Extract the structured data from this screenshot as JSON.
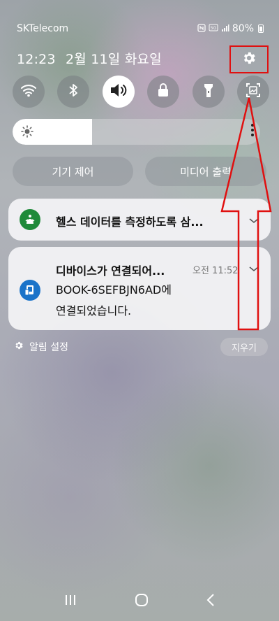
{
  "status_bar": {
    "carrier": "SKTelecom",
    "battery": "80%",
    "icons": [
      "nfc-icon",
      "5g-icon",
      "signal-icon",
      "battery-icon"
    ]
  },
  "header": {
    "time": "12:23",
    "date": "2월 11일 화요일",
    "settings_icon": "gear-icon"
  },
  "quick_settings": [
    {
      "name": "wifi",
      "icon": "wifi-icon",
      "active": false
    },
    {
      "name": "bluetooth",
      "icon": "bluetooth-icon",
      "active": false
    },
    {
      "name": "sound",
      "icon": "speaker-icon",
      "active": true
    },
    {
      "name": "rotation-lock",
      "icon": "lock-icon",
      "active": false
    },
    {
      "name": "flashlight",
      "icon": "flashlight-icon",
      "active": false
    },
    {
      "name": "screen-capture",
      "icon": "screen-capture-icon",
      "active": false
    }
  ],
  "brightness": {
    "level": 0.32,
    "icon": "sun-icon"
  },
  "buttons": {
    "device_control": "기기 제어",
    "media_output": "미디어 출력"
  },
  "notifications": [
    {
      "app_icon": "health-icon",
      "app_color": "#1f8a3a",
      "title": "헬스 데이터를 측정하도록 삼..."
    },
    {
      "app_icon": "device-icon",
      "app_color": "#1a73c9",
      "title": "디바이스가 연결되어...",
      "time": "오전 11:52",
      "body_line1": "BOOK-6SEFBJN6AD에",
      "body_line2": "연결되었습니다."
    }
  ],
  "footer": {
    "notification_settings": "알림 설정",
    "clear": "지우기"
  },
  "annotation": {
    "color": "#e01010"
  },
  "nav_bar": [
    "recents-icon",
    "home-icon",
    "back-icon"
  ]
}
